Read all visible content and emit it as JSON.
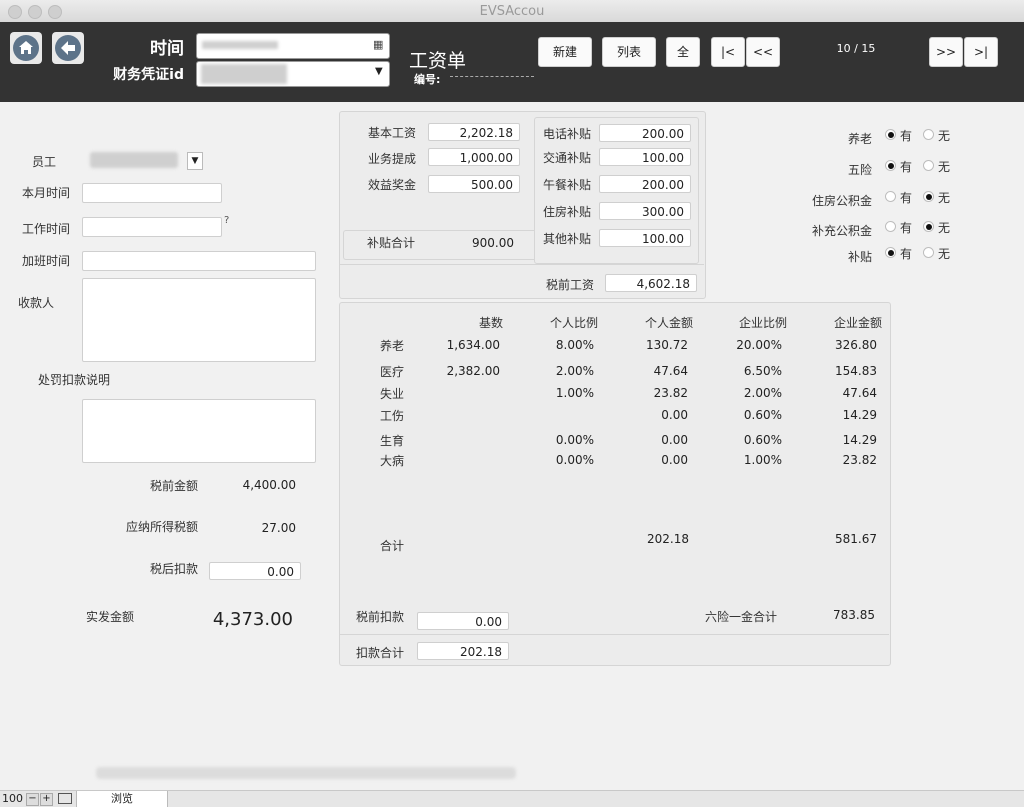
{
  "window": {
    "title": "EVSAccou"
  },
  "header": {
    "time_label": "时间",
    "voucher_label": "财务凭证id",
    "doc_title": "工资单",
    "number_label": "编号:",
    "buttons": {
      "new": "新建",
      "list": "列表",
      "all": "全",
      "first": "|<",
      "prev": "<<",
      "next": ">>",
      "last": ">|"
    },
    "record_counter": "10 / 15"
  },
  "left": {
    "employee_label": "员工",
    "month_time_label": "本月时间",
    "work_time_label": "工作时间",
    "work_time_hint": "?",
    "overtime_label": "加班时间",
    "payee_label": "收款人",
    "penalty_label": "处罚扣款说明",
    "pretax_amount_label": "税前金额",
    "pretax_amount": "4,400.00",
    "taxable_label": "应纳所得税额",
    "taxable": "27.00",
    "aftertax_deduct_label": "税后扣款",
    "aftertax_deduct": "0.00",
    "net_label": "实发金额",
    "net": "4,373.00"
  },
  "salary": {
    "base_label": "基本工资",
    "base": "2,202.18",
    "commission_label": "业务提成",
    "commission": "1,000.00",
    "bonus_label": "效益奖金",
    "bonus": "500.00",
    "phone_label": "电话补贴",
    "phone": "200.00",
    "transport_label": "交通补贴",
    "transport": "100.00",
    "lunch_label": "午餐补贴",
    "lunch": "200.00",
    "housing_label": "住房补贴",
    "housing": "300.00",
    "other_label": "其他补贴",
    "other": "100.00",
    "subsidy_total_label": "补贴合计",
    "subsidy_total": "900.00",
    "pretax_salary_label": "税前工资",
    "pretax_salary": "4,602.18"
  },
  "options": {
    "yes": "有",
    "no": "无",
    "rows": [
      {
        "label": "养老",
        "selected": "有"
      },
      {
        "label": "五险",
        "selected": "有"
      },
      {
        "label": "住房公积金",
        "selected": "无"
      },
      {
        "label": "补充公积金",
        "selected": "无"
      },
      {
        "label": "补贴",
        "selected": "有"
      }
    ]
  },
  "insurance": {
    "headers": [
      "基数",
      "个人比例",
      "个人金额",
      "企业比例",
      "企业金额"
    ],
    "rows": [
      {
        "name": "养老",
        "base": "1,634.00",
        "p_rate": "8.00%",
        "p_amt": "130.72",
        "c_rate": "20.00%",
        "c_amt": "326.80"
      },
      {
        "name": "医疗",
        "base": "2,382.00",
        "p_rate": "2.00%",
        "p_amt": "47.64",
        "c_rate": "6.50%",
        "c_amt": "154.83"
      },
      {
        "name": "失业",
        "base": "",
        "p_rate": "1.00%",
        "p_amt": "23.82",
        "c_rate": "2.00%",
        "c_amt": "47.64"
      },
      {
        "name": "工伤",
        "base": "",
        "p_rate": "",
        "p_amt": "0.00",
        "c_rate": "0.60%",
        "c_amt": "14.29"
      },
      {
        "name": "生育",
        "base": "",
        "p_rate": "0.00%",
        "p_amt": "0.00",
        "c_rate": "0.60%",
        "c_amt": "14.29"
      },
      {
        "name": "大病",
        "base": "",
        "p_rate": "0.00%",
        "p_amt": "0.00",
        "c_rate": "1.00%",
        "c_amt": "23.82"
      }
    ],
    "total_label": "合计",
    "total_personal": "202.18",
    "total_company": "581.67",
    "pretax_deduct_label": "税前扣款",
    "pretax_deduct": "0.00",
    "six_total_label": "六险一金合计",
    "six_total": "783.85",
    "deduct_total_label": "扣款合计",
    "deduct_total": "202.18"
  },
  "status": {
    "zoom": "100",
    "mode": "浏览"
  }
}
